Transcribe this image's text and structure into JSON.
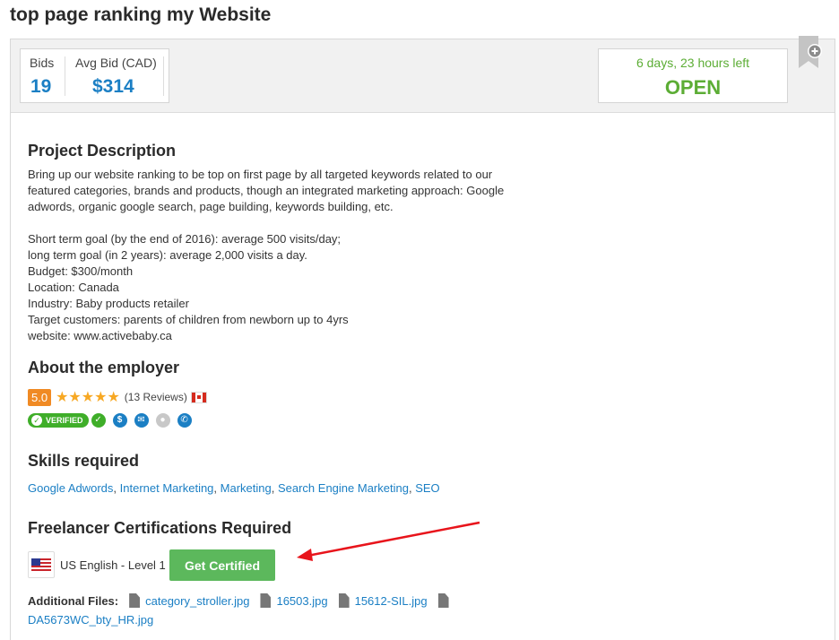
{
  "page": {
    "title": "top page ranking my Website"
  },
  "stats": {
    "bids_label": "Bids",
    "bids_value": "19",
    "avg_label": "Avg Bid (CAD)",
    "avg_value": "$314"
  },
  "status": {
    "time_left": "6 days, 23 hours left",
    "state": "OPEN",
    "color": "#5cad35"
  },
  "description": {
    "heading": "Project Description",
    "lines": [
      "Bring up our website ranking to be top on first page by all targeted keywords related to our",
      "featured categories, brands and products, though an integrated marketing approach: Google",
      "adwords, organic google search, page building, keywords building, etc.",
      "",
      "Short term goal (by the end of 2016): average 500 visits/day;",
      "long term goal (in 2 years): average 2,000 visits a day.",
      "Budget: $300/month",
      "Location: Canada",
      "Industry: Baby products retailer",
      "Target customers: parents of children from newborn up to 4yrs",
      "website: www.activebaby.ca"
    ]
  },
  "employer": {
    "heading": "About the employer",
    "score": "5.0",
    "stars": "★★★★★",
    "reviews": "(13 Reviews)",
    "verified_label": "VERIFIED"
  },
  "skills": {
    "heading": "Skills required",
    "items": [
      "Google Adwords",
      "Internet Marketing",
      "Marketing",
      "Search Engine Marketing",
      "SEO"
    ]
  },
  "certifications": {
    "heading": "Freelancer Certifications Required",
    "item": "US English - Level 1",
    "button": "Get Certified"
  },
  "files": {
    "label": "Additional Files:",
    "items": [
      "category_stroller.jpg",
      "16503.jpg",
      "15612-SIL.jpg",
      "DA5673WC_bty_HR.jpg"
    ]
  },
  "colors": {
    "link": "#1b7fc4",
    "accent_green": "#5cb85c",
    "star": "#f7a823",
    "score_bg": "#f08a24"
  }
}
